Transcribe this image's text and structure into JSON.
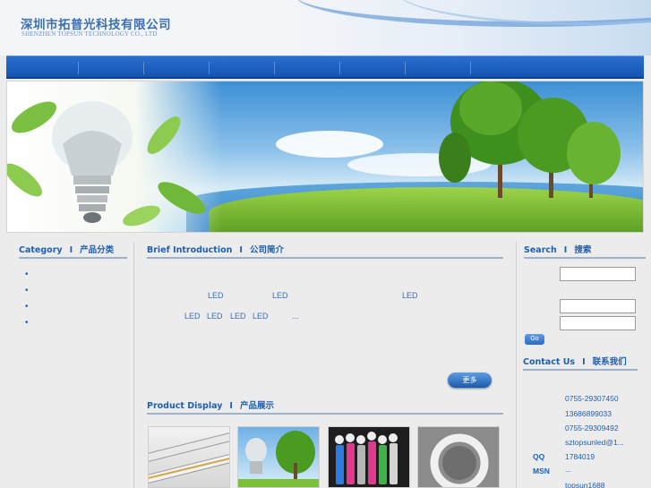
{
  "header": {
    "company_cn": "深圳市拓普光科技有限公司",
    "company_en": "SHENZHEN TOPSUN TECHNOLOGY CO., LTD"
  },
  "category": {
    "title_en": "Category",
    "divider": "I",
    "title_cn": "产品分类",
    "items": [
      "•",
      "•",
      "•",
      "•"
    ]
  },
  "intro": {
    "title_en": "Brief Introduction",
    "divider": "I",
    "title_cn": "公司简介",
    "fragments": [
      "LED",
      "LED",
      "LED",
      "LED",
      "LED",
      "LED",
      "LED",
      "..."
    ],
    "more_label": "更多"
  },
  "products": {
    "title_en": "Product Display",
    "divider": "I",
    "title_cn": "产品展示"
  },
  "search": {
    "title_en": "Search",
    "divider": "I",
    "title_cn": "搜索",
    "go_label": "Go"
  },
  "contact": {
    "title_en": "Contact Us",
    "divider": "I",
    "title_cn": "联系我们",
    "tel": "0755-29307450",
    "mobile": "13686899033",
    "fax": "0755-29309492",
    "email": "sztopsunled@1...",
    "qq_label": "QQ",
    "qq": "1784019",
    "msn_label": "MSN",
    "msn": "...",
    "skype": "topsun1688"
  },
  "colors": {
    "nav": "#1553b0",
    "accent": "#1f5fb0",
    "background": "#ececec"
  }
}
